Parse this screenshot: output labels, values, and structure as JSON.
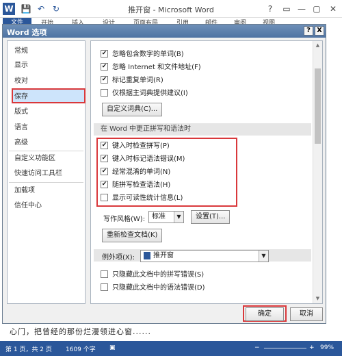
{
  "word": {
    "title": "推开窗 - Microsoft Word",
    "logo": "W",
    "tabs": [
      "文件",
      "开始",
      "插入",
      "设计",
      "页面布局",
      "引用",
      "邮件",
      "审阅",
      "视图"
    ],
    "controls": [
      "?",
      "▭",
      "—",
      "▢",
      "✕"
    ]
  },
  "dialog": {
    "title": "Word 选项",
    "help": "?",
    "close": "X",
    "nav": [
      "常规",
      "显示",
      "校对",
      "保存",
      "版式",
      "语言",
      "高级",
      "自定义功能区",
      "快速访问工具栏",
      "加载项",
      "信任中心"
    ],
    "selected_nav": "校对",
    "options_top": [
      {
        "label": "忽略包含数字的单词(B)",
        "checked": true
      },
      {
        "label": "忽略 Internet 和文件地址(F)",
        "checked": true
      },
      {
        "label": "标记重复单词(R)",
        "checked": true
      },
      {
        "label": "仅根据主词典提供建议(I)",
        "checked": false
      }
    ],
    "custom_dict_button": "自定义词典(C)...",
    "section_title": "在 Word 中更正拼写和语法时",
    "options_main": [
      {
        "label": "键入时检查拼写(P)",
        "checked": true
      },
      {
        "label": "键入时标记语法错误(M)",
        "checked": true
      },
      {
        "label": "经常混淆的单词(N)",
        "checked": true
      },
      {
        "label": "随拼写检查语法(H)",
        "checked": true
      },
      {
        "label": "显示可读性统计信息(L)",
        "checked": false
      }
    ],
    "writing_style_label": "写作风格(W):",
    "writing_style_value": "标准",
    "settings_button": "设置(T)...",
    "recheck_button": "重新检查文档(K)",
    "exceptions_label": "例外项(X):",
    "exceptions_value": "推开窗",
    "options_bottom": [
      {
        "label": "只隐藏此文档中的拼写错误(S)",
        "checked": false
      },
      {
        "label": "只隐藏此文档中的语法错误(D)",
        "checked": false
      }
    ],
    "ok_button": "确定",
    "cancel_button": "取消"
  },
  "document": {
    "text": "心门，把曾经的那份烂漫领进心窗......"
  },
  "statusbar": {
    "page": "第 1 页，共 2 页",
    "words": "1609 个字",
    "zoom": "99%"
  },
  "icons": {
    "checkmark": "✔",
    "dropdown": "▼",
    "scroll_up": "▲",
    "scroll_down": "▼"
  }
}
